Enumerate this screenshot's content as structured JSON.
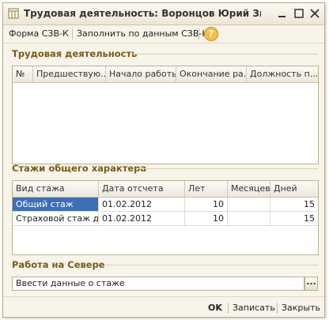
{
  "window": {
    "title": "Трудовая деятельность: Воронцов Юрий Зиновьевич"
  },
  "toolbar": {
    "form_label": "Форма СЗВ-К",
    "fill_label": "Заполнить по данным СЗВ-К",
    "help_symbol": "?"
  },
  "labor": {
    "title": "Трудовая деятельность",
    "columns": [
      "№",
      "Предшествую...",
      "Начало работы",
      "Окончание ра...",
      "Должность п..."
    ]
  },
  "general": {
    "title": "Стажи общего характера",
    "columns": [
      "Вид стажа",
      "Дата отсчета",
      "Лет",
      "Месяцев",
      "Дней"
    ],
    "rows": [
      {
        "type": "Общий стаж",
        "date": "01.02.2012",
        "years": "10",
        "months": "",
        "days": "15"
      },
      {
        "type": "Страховой стаж д...",
        "date": "01.02.2012",
        "years": "10",
        "months": "",
        "days": "15"
      }
    ]
  },
  "north": {
    "title": "Работа на Севере",
    "value": "Ввести данные о стаже",
    "button_label": "..."
  },
  "footer": {
    "ok_label": "OK",
    "save_label": "Записать",
    "close_label": "Закрыть"
  }
}
